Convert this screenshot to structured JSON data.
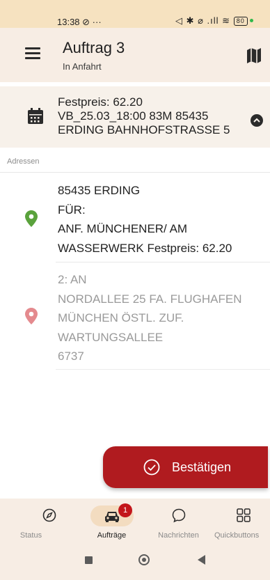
{
  "status_bar": {
    "time": "13:38",
    "indicators": "⊘ ···",
    "right_icons": "◁ ✱ ⌀ .ıll ≋",
    "battery": "80"
  },
  "app_bar": {
    "title": "Auftrag 3",
    "subtitle": "In Anfahrt",
    "menu_icon": "menu-icon",
    "map_icon": "map-icon"
  },
  "summary": {
    "lines": [
      "Festpreis: 62.20",
      "VB_25.03_18:00 83M 85435",
      "ERDING BAHNHOFSTRASSE 5"
    ],
    "icon": "calendar-icon"
  },
  "addresses_label": "Adressen",
  "addresses": [
    {
      "lines": [
        "85435 ERDING",
        "FÜR:",
        "ANF. MÜNCHENER/ AM",
        "WASSERWERK Festpreis: 62.20"
      ],
      "marker_color": "#5aa23c"
    },
    {
      "lines": [
        "2: AN",
        "NORDALLEE 25 FA. FLUGHAFEN",
        "MÜNCHEN ÖSTL. ZUF.",
        "WARTUNGSALLEE",
        "6737"
      ],
      "marker_color": "#e48a8e"
    }
  ],
  "confirm_button": {
    "label": "Bestätigen"
  },
  "bottom_nav": [
    {
      "label": "Status",
      "icon": "compass-icon"
    },
    {
      "label": "Aufträge",
      "icon": "car-icon",
      "badge": "1",
      "active": true
    },
    {
      "label": "Nachrichten",
      "icon": "chat-icon"
    },
    {
      "label": "Quickbuttons",
      "icon": "grid-icon"
    }
  ],
  "colors": {
    "accent": "#b01b1f",
    "bar_bg": "#f7ede4",
    "status_bg": "#f6e2c0"
  }
}
